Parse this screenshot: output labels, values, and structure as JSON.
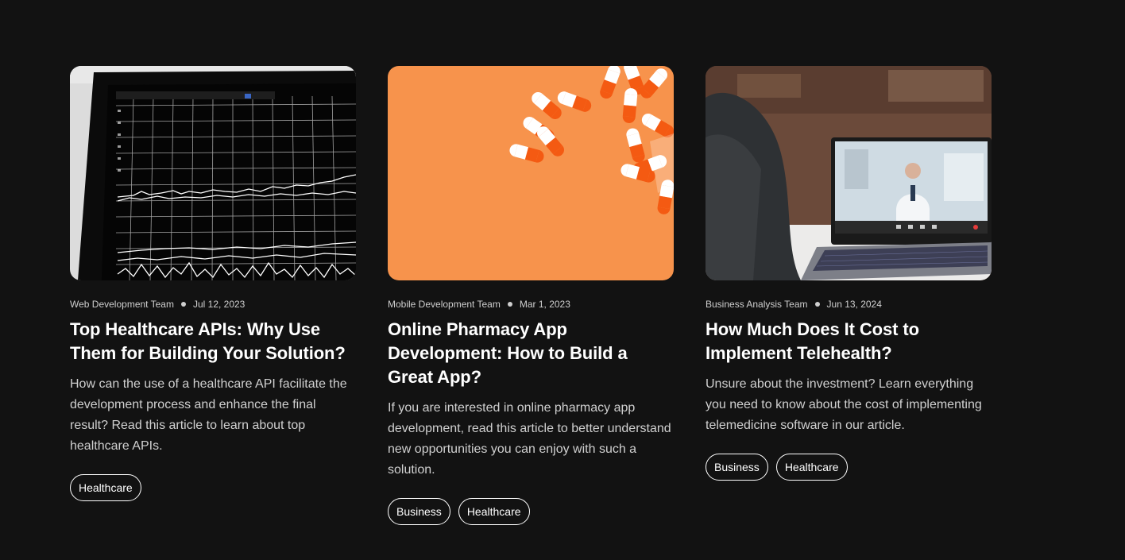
{
  "articles": [
    {
      "image": "trading-chart-monitor-photo",
      "author": "Web Development Team",
      "date": "Jul 12, 2023",
      "title": "Top Healthcare APIs: Why Use Them for Building Your Solution?",
      "excerpt": "How can the use of a healthcare API facilitate the development process and enhance the final result? Read this article to learn about top healthcare APIs.",
      "tags": [
        "Healthcare"
      ]
    },
    {
      "image": "orange-capsules-photo",
      "author": "Mobile Development Team",
      "date": "Mar 1, 2023",
      "title": "Online Pharmacy App Development: How to Build a Great App?",
      "excerpt": "If you are interested in online pharmacy app development, read this article to better understand new opportunities you can enjoy with such a solution.",
      "tags": [
        "Business",
        "Healthcare"
      ]
    },
    {
      "image": "telehealth-laptop-doctor-photo",
      "author": "Business Analysis Team",
      "date": "Jun 13, 2024",
      "title": "How Much Does It Cost to Implement Telehealth?",
      "excerpt": "Unsure about the investment? Learn everything you need to know about the cost of implementing telemedicine software in our article.",
      "tags": [
        "Business",
        "Healthcare"
      ]
    }
  ],
  "colors": {
    "background": "#121212",
    "text": "#ffffff",
    "muted_text": "#d0d0d0",
    "pill_border": "#ffffff",
    "pharmacy_orange": "#f7934c"
  }
}
